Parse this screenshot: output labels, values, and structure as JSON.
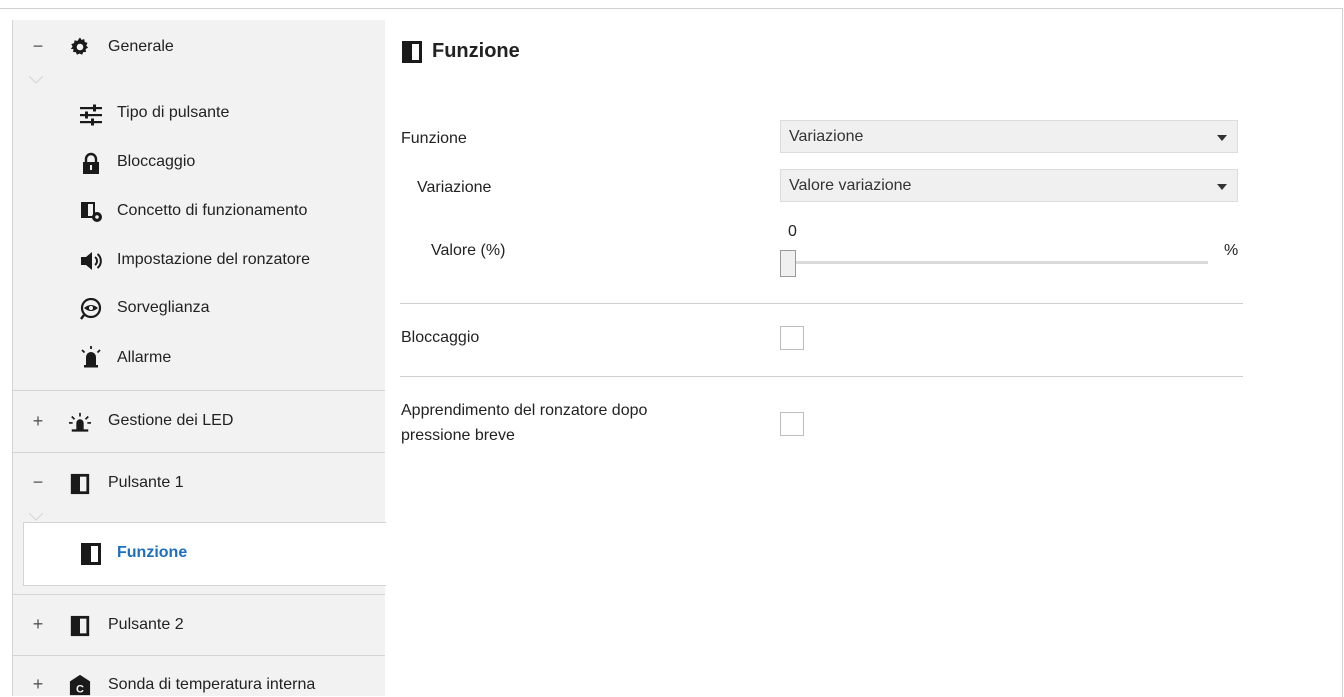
{
  "sidebar": {
    "generale": {
      "toggle": "−",
      "label": "Generale",
      "icon": "gear-icon"
    },
    "generale_items": [
      {
        "label": "Tipo di pulsante",
        "icon": "sliders-icon"
      },
      {
        "label": "Bloccaggio",
        "icon": "lock-icon"
      },
      {
        "label": "Concetto di funzionamento",
        "icon": "button-gear-icon"
      },
      {
        "label": "Impostazione del ronzatore",
        "icon": "speaker-icon"
      },
      {
        "label": "Sorveglianza",
        "icon": "eye-icon"
      },
      {
        "label": "Allarme",
        "icon": "alarm-icon"
      }
    ],
    "gestione_led": {
      "toggle": "+",
      "label": "Gestione dei LED",
      "icon": "led-icon"
    },
    "pulsante1": {
      "toggle": "−",
      "label": "Pulsante 1",
      "icon": "pushbutton-icon"
    },
    "pulsante1_items": [
      {
        "label": "Funzione",
        "icon": "pushbutton-icon",
        "selected": true
      }
    ],
    "pulsante2": {
      "toggle": "+",
      "label": "Pulsante 2",
      "icon": "pushbutton-icon"
    },
    "sonda": {
      "toggle": "+",
      "label": "Sonda di temperatura interna",
      "icon": "temperature-sensor-icon"
    }
  },
  "main": {
    "title": "Funzione",
    "funzione": {
      "label": "Funzione",
      "value": "Variazione"
    },
    "variazione": {
      "label": "Variazione",
      "value": "Valore variazione"
    },
    "valore": {
      "label": "Valore (%)",
      "slider_value": "0",
      "unit": "%",
      "level": 0
    },
    "bloccaggio": {
      "label": "Bloccaggio",
      "checked": false
    },
    "apprendimento": {
      "label_line1": "Apprendimento del ronzatore dopo",
      "label_line2": "pressione breve",
      "checked": false
    }
  },
  "colors": {
    "selected_text": "#1e6fbd",
    "sidebar_bg": "#f2f2f2"
  }
}
